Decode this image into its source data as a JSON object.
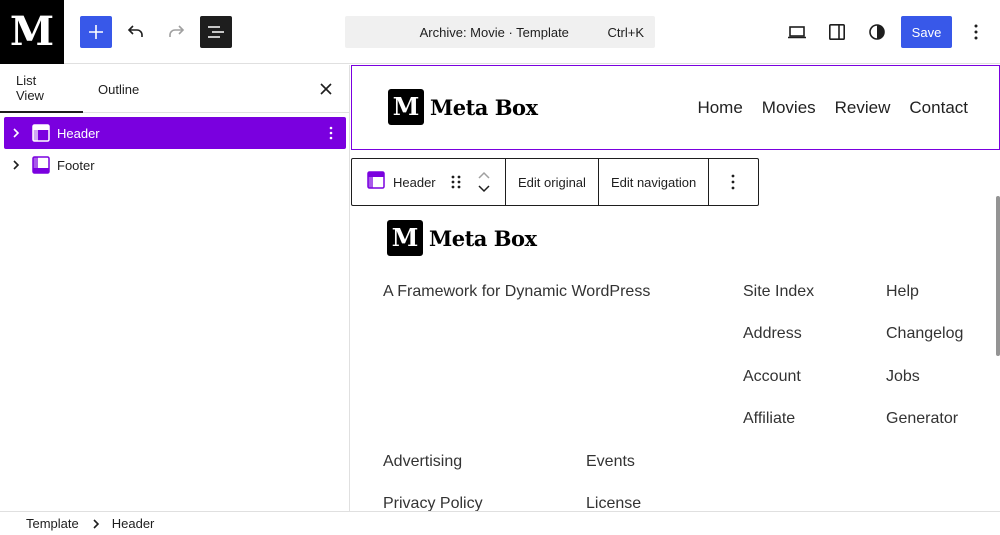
{
  "app": {
    "logo_letter": "M",
    "title": "Archive: Movie · Template",
    "shortcut": "Ctrl+K",
    "save_label": "Save",
    "accent_color": "#3858e9",
    "selection_color": "#7a00df",
    "icons": {
      "add": "plus-icon",
      "undo": "undo-icon",
      "redo": "redo-icon",
      "document_overview": "list-view-icon",
      "device_preview": "laptop-icon",
      "settings": "sidebar-toggle-icon",
      "styles": "half-circle-icon",
      "options": "vertical-ellipsis-icon"
    }
  },
  "panel": {
    "tabs": [
      {
        "label": "List View",
        "active": true
      },
      {
        "label": "Outline",
        "active": false
      }
    ],
    "items": [
      {
        "label": "Header",
        "icon": "template-part-header-icon",
        "selected": true
      },
      {
        "label": "Footer",
        "icon": "template-part-footer-icon",
        "selected": false
      }
    ]
  },
  "canvas": {
    "header": {
      "logo_letter": "M",
      "site_name": "Meta Box",
      "nav": [
        "Home",
        "Movies",
        "Review",
        "Contact"
      ]
    },
    "block_toolbar": {
      "parent_label": "Header",
      "edit_original": "Edit original",
      "edit_navigation": "Edit navigation"
    },
    "footer": {
      "logo_letter": "M",
      "site_name": "Meta Box",
      "tagline": "A Framework for Dynamic WordPress",
      "links_col1": [
        "Site Index",
        "Address",
        "Account",
        "Affiliate"
      ],
      "links_col2": [
        "Help",
        "Changelog",
        "Jobs",
        "Generator"
      ],
      "links_bottom_left": [
        "Advertising",
        "Privacy Policy"
      ],
      "links_bottom_right": [
        "Events",
        "License"
      ]
    }
  },
  "breadcrumb": [
    "Template",
    "Header"
  ]
}
